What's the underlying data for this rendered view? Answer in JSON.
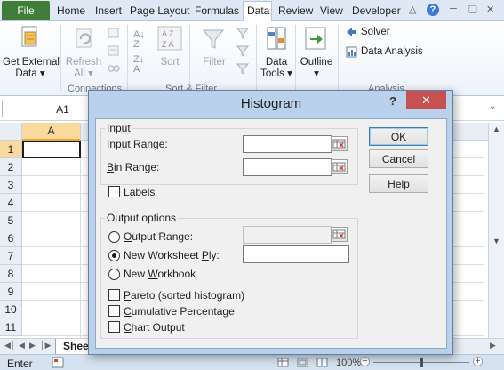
{
  "ribbon": {
    "file_tab": "File",
    "tabs": [
      "Home",
      "Insert",
      "Page Layout",
      "Formulas",
      "Data",
      "Review",
      "View",
      "Developer"
    ],
    "active_tab": "Data",
    "buttons": {
      "get_external_data_line1": "Get External",
      "get_external_data_line2": "Data ▾",
      "refresh_all_line1": "Refresh",
      "refresh_all_line2": "All ▾",
      "sort": "Sort",
      "filter": "Filter",
      "data_tools_line1": "Data",
      "data_tools_line2": "Tools ▾",
      "outline_line1": "Outline",
      "outline_line2": "▾",
      "solver": "Solver",
      "data_analysis": "Data Analysis"
    },
    "groups": {
      "connections": "Connections",
      "sort_filter": "Sort & Filter",
      "analysis": "Analysis"
    },
    "colors": {
      "file_tab": "#3f7d39",
      "ribbon_bg": "#dfe9f5"
    }
  },
  "formula_bar": {
    "name_box": "A1"
  },
  "grid": {
    "columns": [
      "A"
    ],
    "rows": [
      "1",
      "2",
      "3",
      "4",
      "5",
      "6",
      "7",
      "8",
      "9",
      "10",
      "11"
    ],
    "active_cell": "A1",
    "sheet_tab": "Sheet1"
  },
  "status_bar": {
    "mode": "Enter",
    "zoom": "100%"
  },
  "dialog": {
    "title": "Histogram",
    "help_glyph": "?",
    "close_glyph": "✕",
    "input": {
      "legend": "Input",
      "input_range_label": {
        "pre": "",
        "key": "I",
        "post": "nput Range:"
      },
      "bin_range_label": {
        "pre": "",
        "key": "B",
        "post": "in Range:"
      },
      "input_range_value": "",
      "bin_range_value": "",
      "labels_checkbox": {
        "pre": "",
        "key": "L",
        "post": "abels"
      },
      "labels_checked": false
    },
    "output": {
      "legend": "Output options",
      "output_range_label": {
        "pre": "",
        "key": "O",
        "post": "utput Range:"
      },
      "new_worksheet_label": {
        "pre": "New Worksheet ",
        "key": "P",
        "post": "ly:"
      },
      "new_workbook_label": {
        "pre": "New ",
        "key": "W",
        "post": "orkbook"
      },
      "selected": "new_worksheet",
      "pareto": {
        "pre": "",
        "key": "P",
        "post": "areto (sorted histogram)"
      },
      "cumulative": {
        "pre": "",
        "key": "C",
        "post": "umulative Percentage"
      },
      "chart_output": {
        "pre": "",
        "key": "C",
        "post": "hart Output"
      }
    },
    "buttons": {
      "ok": "OK",
      "cancel": "Cancel",
      "help": {
        "pre": "",
        "key": "H",
        "post": "elp"
      }
    }
  }
}
